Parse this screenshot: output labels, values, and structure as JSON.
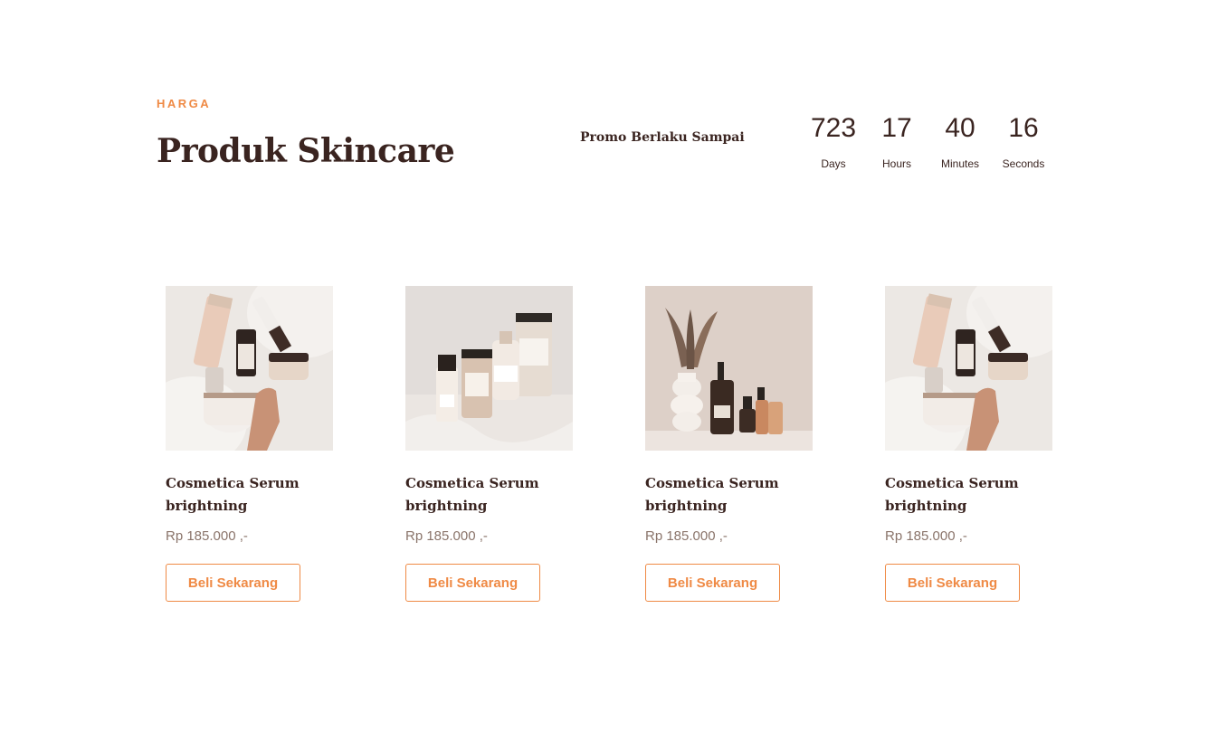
{
  "header": {
    "eyebrow": "HARGA",
    "title": "Produk Skincare"
  },
  "promo": {
    "label": "Promo Berlaku Sampai",
    "countdown": [
      {
        "value": "723",
        "label": "Days"
      },
      {
        "value": "17",
        "label": "Hours"
      },
      {
        "value": "40",
        "label": "Minutes"
      },
      {
        "value": "16",
        "label": "Seconds"
      }
    ]
  },
  "products": [
    {
      "name": "Cosmetica Serum brightning",
      "price": "Rp 185.000 ,-",
      "button_label": "Beli Sekarang",
      "image": "skincare-flatlay-fur"
    },
    {
      "name": "Cosmetica Serum brightning",
      "price": "Rp 185.000 ,-",
      "button_label": "Beli Sekarang",
      "image": "skincare-bottles-tubes"
    },
    {
      "name": "Cosmetica Serum brightning",
      "price": "Rp 185.000 ,-",
      "button_label": "Beli Sekarang",
      "image": "skincare-vase-bottles"
    },
    {
      "name": "Cosmetica Serum brightning",
      "price": "Rp 185.000 ,-",
      "button_label": "Beli Sekarang",
      "image": "skincare-flatlay-fur"
    }
  ],
  "colors": {
    "accent": "#ef8a45",
    "heading": "#3a2420",
    "price": "#8a746a"
  }
}
